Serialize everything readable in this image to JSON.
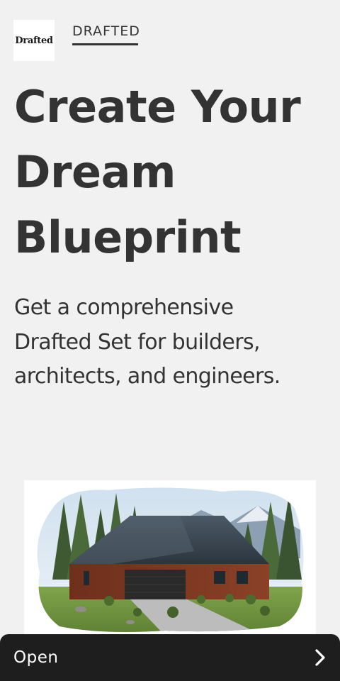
{
  "header": {
    "logo_text": "Drafted",
    "nav_tab_label": "DRAFTED"
  },
  "hero": {
    "title_lines": [
      "Create Your",
      "Dream",
      "Blueprint"
    ],
    "subtitle_lines": [
      "Get a comprehensive",
      "Drafted Set for builders,",
      "architects, and engineers."
    ]
  },
  "illustration": {
    "icon": "house-illustration"
  },
  "footer_bar": {
    "label": "Open",
    "icon": "chevron-right-icon"
  },
  "colors": {
    "background": "#f1f1f1",
    "text": "#333333",
    "bar": "#1e1e1e",
    "bar_text": "#ffffff"
  }
}
